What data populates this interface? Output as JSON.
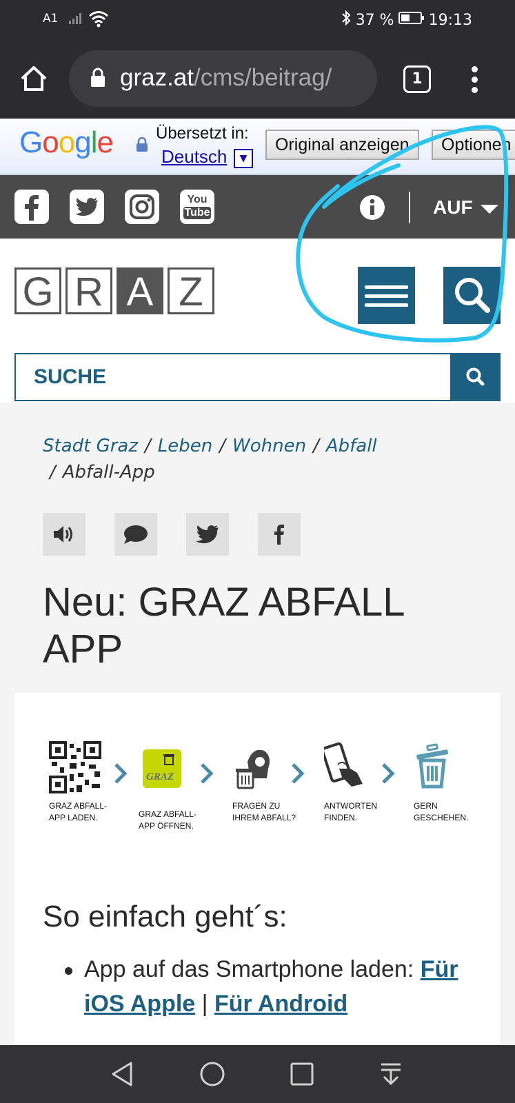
{
  "status_bar": {
    "carrier": "A1",
    "battery": "37 %",
    "time": "19:13",
    "icons": [
      "signal-icon",
      "wifi-icon",
      "bluetooth-icon",
      "battery-icon"
    ]
  },
  "browser": {
    "url_host": "graz.at",
    "url_path": "/cms/beitrag/",
    "tab_count": "1"
  },
  "translate_bar": {
    "label": "Übersetzt in:",
    "language": "Deutsch",
    "original_button": "Original anzeigen",
    "options_button": "Optionen"
  },
  "social_bar": {
    "icons": [
      "facebook-icon",
      "twitter-icon",
      "instagram-icon",
      "youtube-icon"
    ],
    "youtube_text_top": "You",
    "youtube_text_bottom": "Tube",
    "language_button": "AUF"
  },
  "header": {
    "logo_letters": [
      "G",
      "R",
      "A",
      "Z"
    ],
    "search_label": "SUCHE"
  },
  "breadcrumb": {
    "items": [
      "Stadt Graz",
      "Leben",
      "Wohnen",
      "Abfall"
    ],
    "current": "Abfall-App"
  },
  "page": {
    "title": "Neu: GRAZ ABFALL APP",
    "steps": [
      {
        "line1": "GRAZ ABFALL-",
        "line2": "APP LADEN."
      },
      {
        "line1": "GRAZ ABFALL-",
        "line2": "APP ÖFFNEN."
      },
      {
        "line1": "FRAGEN ZU",
        "line2": "IHREM ABFALL?"
      },
      {
        "line1": "ANTWORTEN",
        "line2": "FINDEN."
      },
      {
        "line1": "GERN",
        "line2": "GESCHEHEN."
      }
    ],
    "app_icon_text": "GRAZ",
    "subheading": "So einfach geht´s:",
    "bullet_text": "App auf das Smartphone laden:",
    "link_ios": "Für iOS Apple",
    "link_separator": "|",
    "link_android": "Für Android"
  },
  "colors": {
    "brand_blue": "#1d5f80",
    "annotation": "#2ec4f0",
    "social_bar": "#4a4a4a"
  }
}
